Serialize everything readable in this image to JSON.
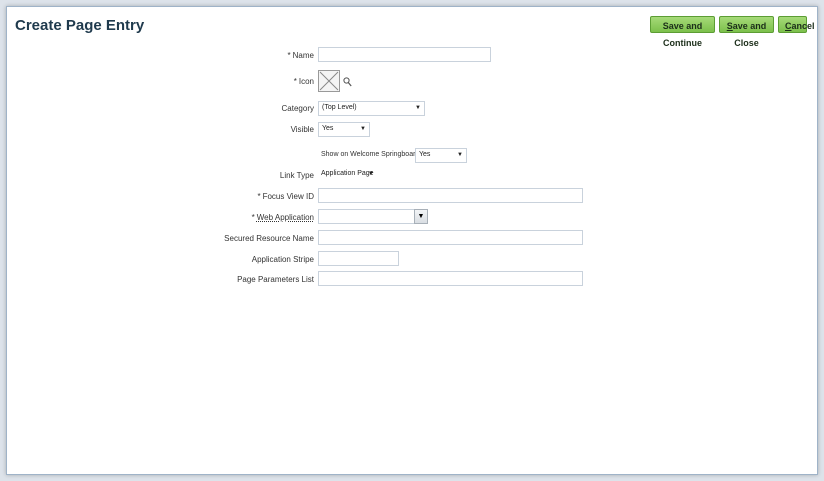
{
  "page": {
    "title": "Create Page Entry"
  },
  "toolbar": {
    "save_continue": "Save and Continue",
    "save_close_prefix": "S",
    "save_close_rest": "ave and Close",
    "cancel_prefix": "C",
    "cancel_rest": "ancel"
  },
  "form": {
    "required_marker": "*",
    "name_label": "Name",
    "name_value": "",
    "icon_label": "Icon",
    "category_label": "Category",
    "category_value": "(Top Level)",
    "visible_label": "Visible",
    "visible_value": "Yes",
    "springboard_label": "Show on Welcome Springboard",
    "springboard_value": "Yes",
    "link_type_label": "Link Type",
    "link_type_value": "Application Page",
    "focus_view_label": "Focus View ID",
    "focus_view_value": "",
    "web_app_label": "Web Application",
    "web_app_value": "",
    "secured_resource_label": "Secured Resource Name",
    "secured_resource_value": "",
    "app_stripe_label": "Application Stripe",
    "app_stripe_value": "",
    "page_params_label": "Page Parameters List",
    "page_params_value": ""
  },
  "icons": {
    "placeholder": "image-placeholder-icon",
    "search": "search-icon",
    "dropdown": "chevron-down-icon"
  }
}
